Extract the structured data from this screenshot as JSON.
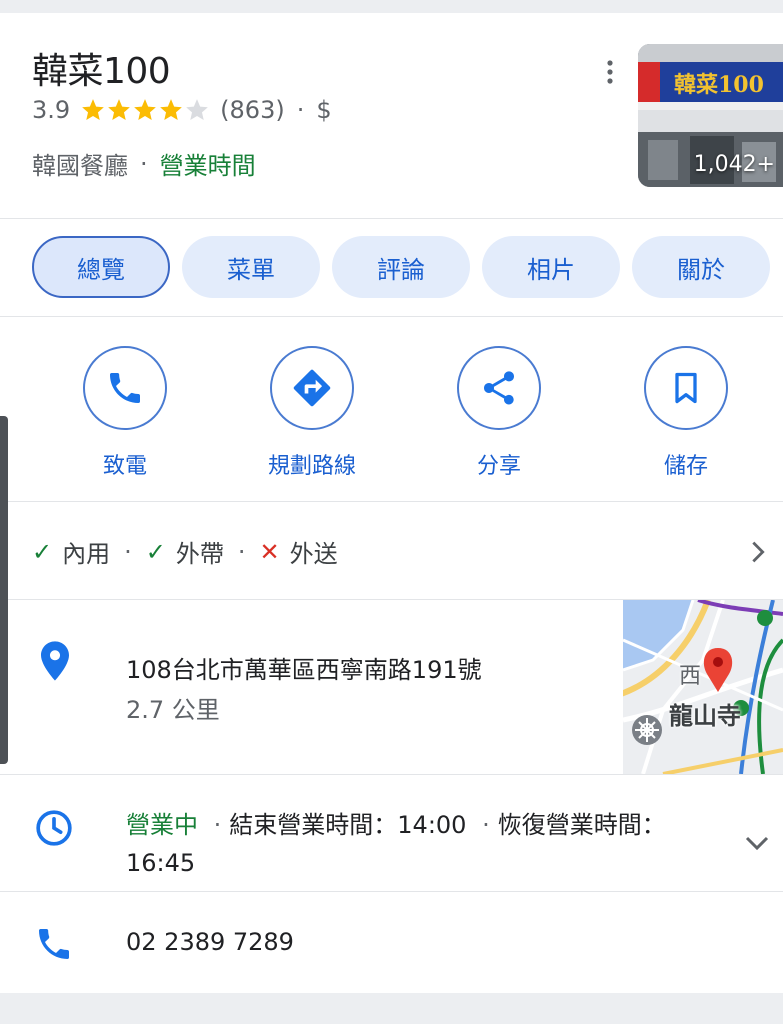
{
  "place": {
    "name": "韓菜100",
    "rating": "3.9",
    "stars_filled": 4,
    "stars_total": 5,
    "review_count": "(863)",
    "price": "$",
    "category": "韓國餐廳",
    "hours_link": "營業時間",
    "photo_count": "1,042+",
    "photo_sign_text": "韓菜100"
  },
  "tabs": [
    {
      "label": "總覽",
      "active": true
    },
    {
      "label": "菜單",
      "active": false
    },
    {
      "label": "評論",
      "active": false
    },
    {
      "label": "相片",
      "active": false
    },
    {
      "label": "關於",
      "active": false
    }
  ],
  "actions": [
    {
      "label": "致電",
      "icon": "phone-icon"
    },
    {
      "label": "規劃路線",
      "icon": "directions-icon"
    },
    {
      "label": "分享",
      "icon": "share-icon"
    },
    {
      "label": "儲存",
      "icon": "bookmark-icon"
    }
  ],
  "service_options": [
    {
      "label": "內用",
      "available": true
    },
    {
      "label": "外帶",
      "available": true
    },
    {
      "label": "外送",
      "available": false
    }
  ],
  "address": {
    "line": "108台北市萬華區西寧南路191號",
    "distance": "2.7 公里"
  },
  "map": {
    "landmark": "龍山寺",
    "district_char": "西"
  },
  "hours": {
    "status": "營業中",
    "closing": "結束營業時間：14:00",
    "reopen_label": "恢復營業時間：",
    "reopen_time": "16:45"
  },
  "phone": "02 2389 7289",
  "colors": {
    "accent": "#1a73e8",
    "open_green": "#188038",
    "star_gold": "#fbbc04",
    "cross_red": "#d93025"
  }
}
